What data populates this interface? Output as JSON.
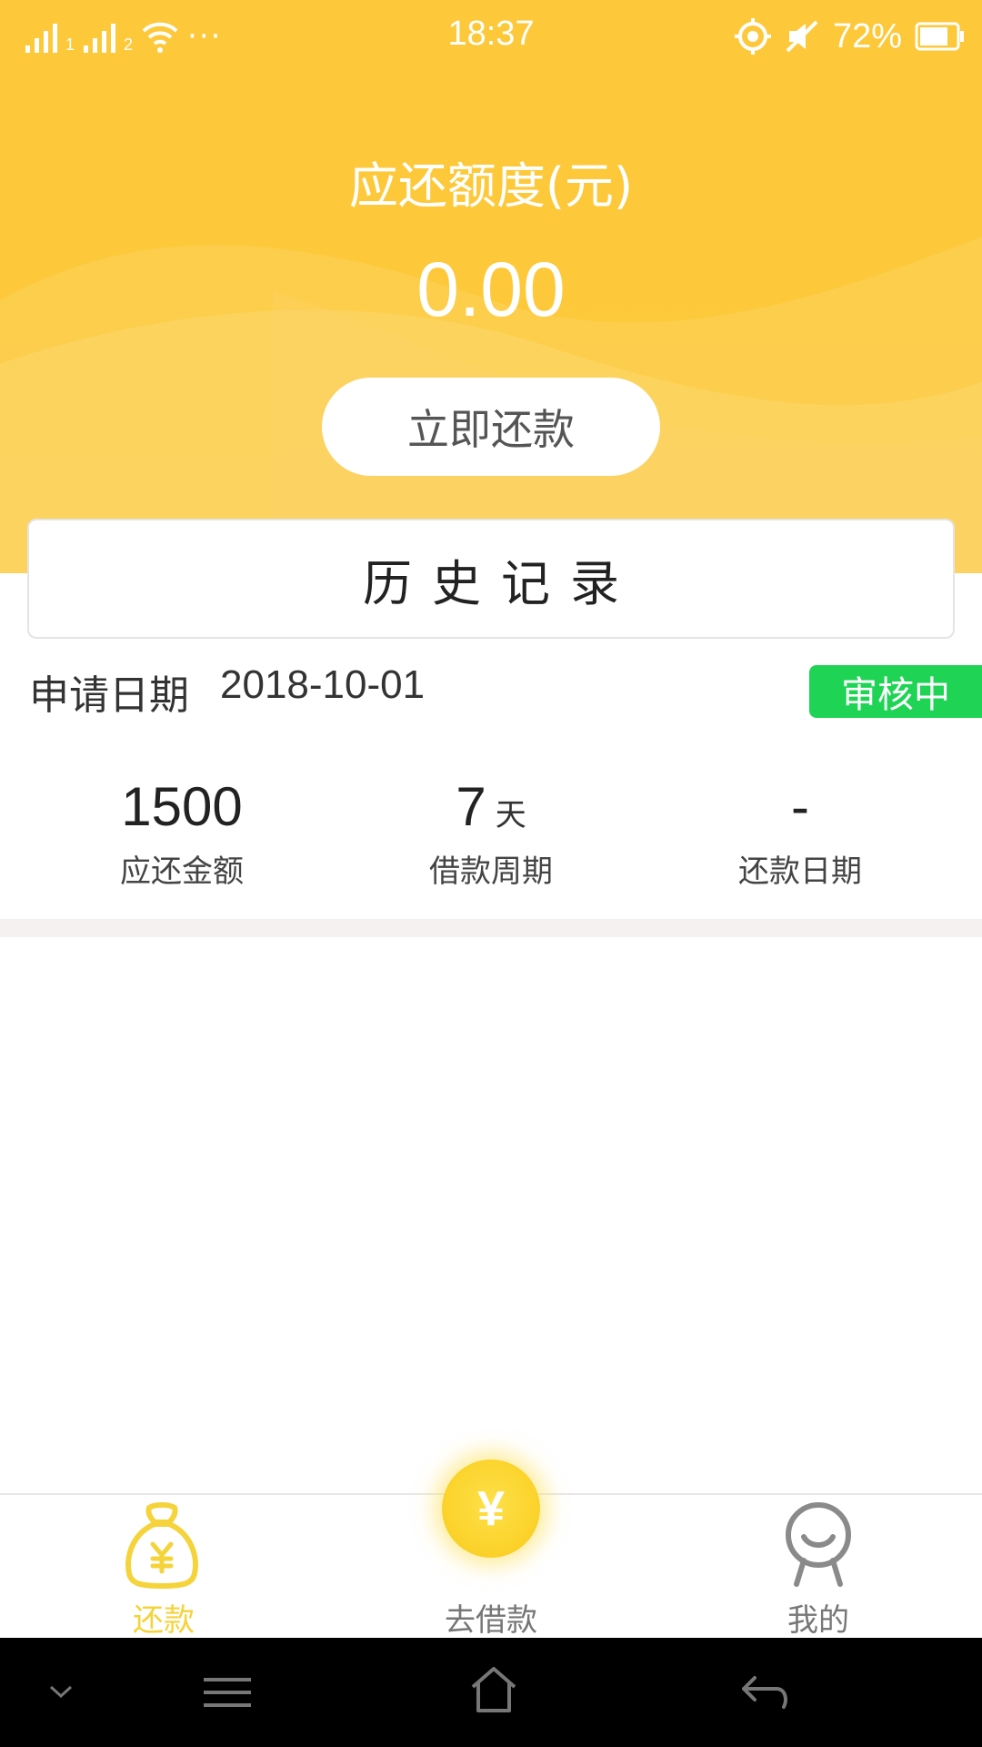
{
  "status_bar": {
    "time": "18:37",
    "battery": "72%",
    "sim1": "1",
    "sim2": "2",
    "more": "···",
    "icons": [
      "signal-icon",
      "wifi-icon",
      "location-icon",
      "mute-icon",
      "battery-icon"
    ]
  },
  "header": {
    "title": "应还额度(元)",
    "amount": "0.00",
    "repay_button": "立即还款"
  },
  "history": {
    "label": "历史记录"
  },
  "record": {
    "apply_label": "申请日期",
    "apply_date": "2018-10-01",
    "status": "审核中",
    "stats": [
      {
        "value": "1500",
        "unit": "",
        "label": "应还金额"
      },
      {
        "value": "7",
        "unit": "天",
        "label": "借款周期"
      },
      {
        "value": "-",
        "unit": "",
        "label": "还款日期"
      }
    ]
  },
  "tabs": [
    {
      "label": "还款",
      "icon": "money-bag-icon",
      "active": true
    },
    {
      "label": "去借款",
      "icon": "yuan-coin-icon",
      "active": false
    },
    {
      "label": "我的",
      "icon": "user-face-icon",
      "active": false
    }
  ],
  "borrow_coin_symbol": "¥",
  "colors": {
    "brand_yellow": "#fdc93a",
    "active_tab": "#f5d33a",
    "inactive_tab": "#777777",
    "status_green": "#1fd454"
  },
  "nav_bar": {
    "icons": [
      "chevron-down-icon",
      "menu-icon",
      "home-icon",
      "back-icon"
    ]
  }
}
